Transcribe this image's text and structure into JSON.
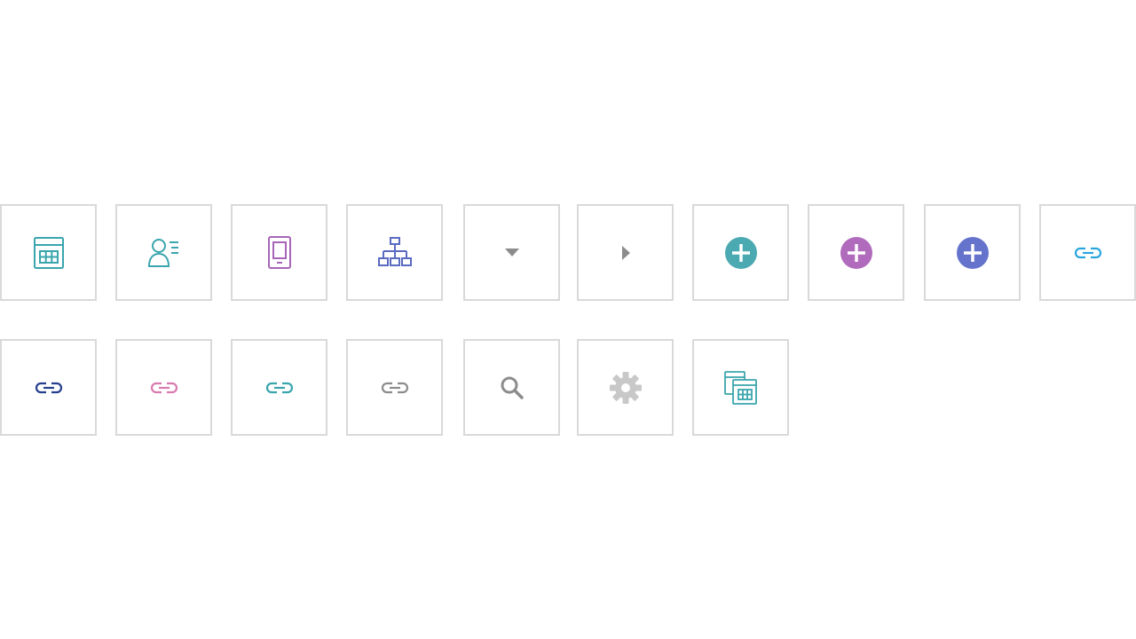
{
  "icon_grid": {
    "rows": [
      {
        "tiles": [
          {
            "icon": "table-grid-icon",
            "color": "#3aa5ad"
          },
          {
            "icon": "user-list-icon",
            "color": "#3aa5ad"
          },
          {
            "icon": "tablet-icon",
            "color": "#a766b8"
          },
          {
            "icon": "hierarchy-icon",
            "color": "#5a6bc2"
          },
          {
            "icon": "caret-down-icon",
            "color": "#8c8c8c"
          },
          {
            "icon": "caret-right-icon",
            "color": "#8c8c8c"
          },
          {
            "icon": "add-circle-icon",
            "color": "#4aa9b1"
          },
          {
            "icon": "add-circle-icon",
            "color": "#b06bbc"
          },
          {
            "icon": "add-circle-icon",
            "color": "#6573cc"
          },
          {
            "icon": "link-icon",
            "color": "#2aa6df"
          }
        ]
      },
      {
        "tiles": [
          {
            "icon": "link-icon",
            "color": "#263f8c"
          },
          {
            "icon": "link-icon",
            "color": "#d97bb0"
          },
          {
            "icon": "link-icon",
            "color": "#3aa5ad"
          },
          {
            "icon": "link-icon",
            "color": "#8c8c8c"
          },
          {
            "icon": "search-icon",
            "color": "#8c8c8c"
          },
          {
            "icon": "gear-icon",
            "color": "#c8c8c8"
          },
          {
            "icon": "duplicate-table-icon",
            "color": "#3aa5ad"
          }
        ]
      }
    ]
  }
}
